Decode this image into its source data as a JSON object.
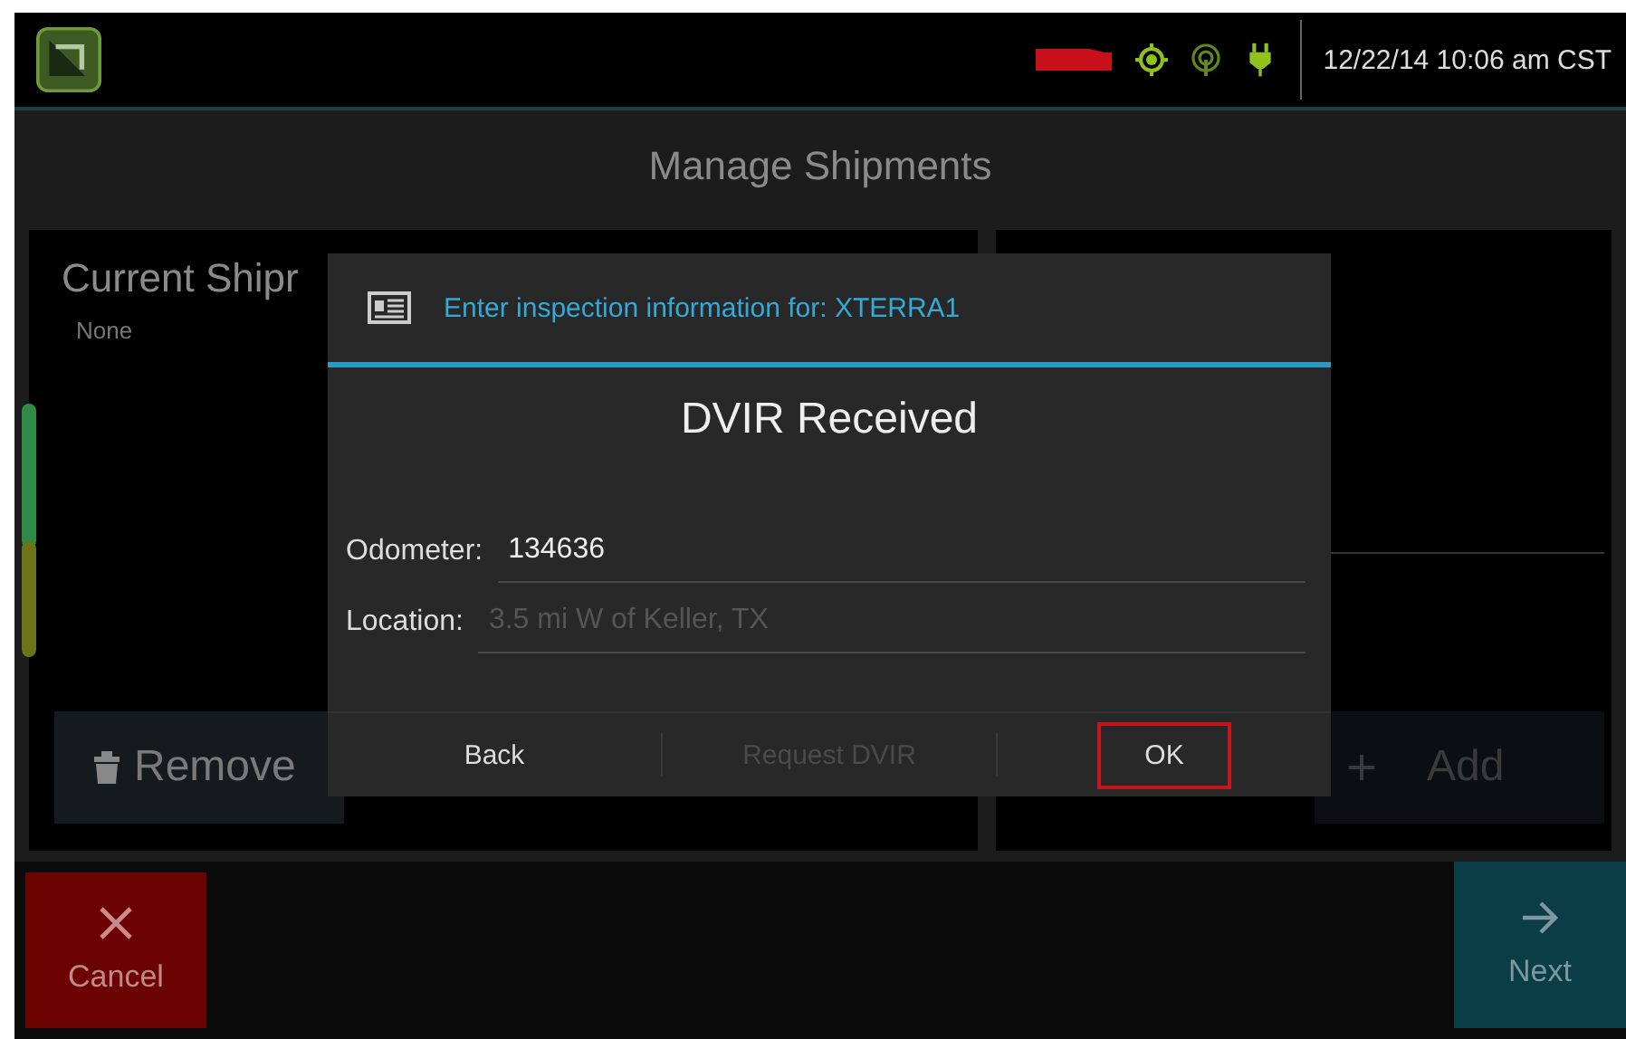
{
  "status_bar": {
    "datetime": "12/22/14 10:06 am CST"
  },
  "title": "Manage Shipments",
  "left_panel": {
    "title": "Current Shipr",
    "value": "None",
    "button": {
      "label": "Remove",
      "disabled": false
    }
  },
  "right_panel": {
    "button": {
      "label": "Add",
      "disabled": true
    }
  },
  "dialog": {
    "header": "Enter inspection information for: XTERRA1",
    "title": "DVIR Received",
    "fields": [
      {
        "label": "Odometer:",
        "value": "134636",
        "disabled": false
      },
      {
        "label": "Location:",
        "value": "3.5 mi W of Keller, TX",
        "disabled": true
      }
    ],
    "buttons": [
      {
        "label": "Back",
        "disabled": false,
        "highlighted": false
      },
      {
        "label": "Request DVIR",
        "disabled": true,
        "highlighted": false
      },
      {
        "label": "OK",
        "disabled": false,
        "highlighted": true
      }
    ]
  },
  "bottom_bar": [
    {
      "label": "Cancel",
      "kind": "cancel"
    },
    {
      "label": "Next",
      "kind": "next"
    }
  ]
}
